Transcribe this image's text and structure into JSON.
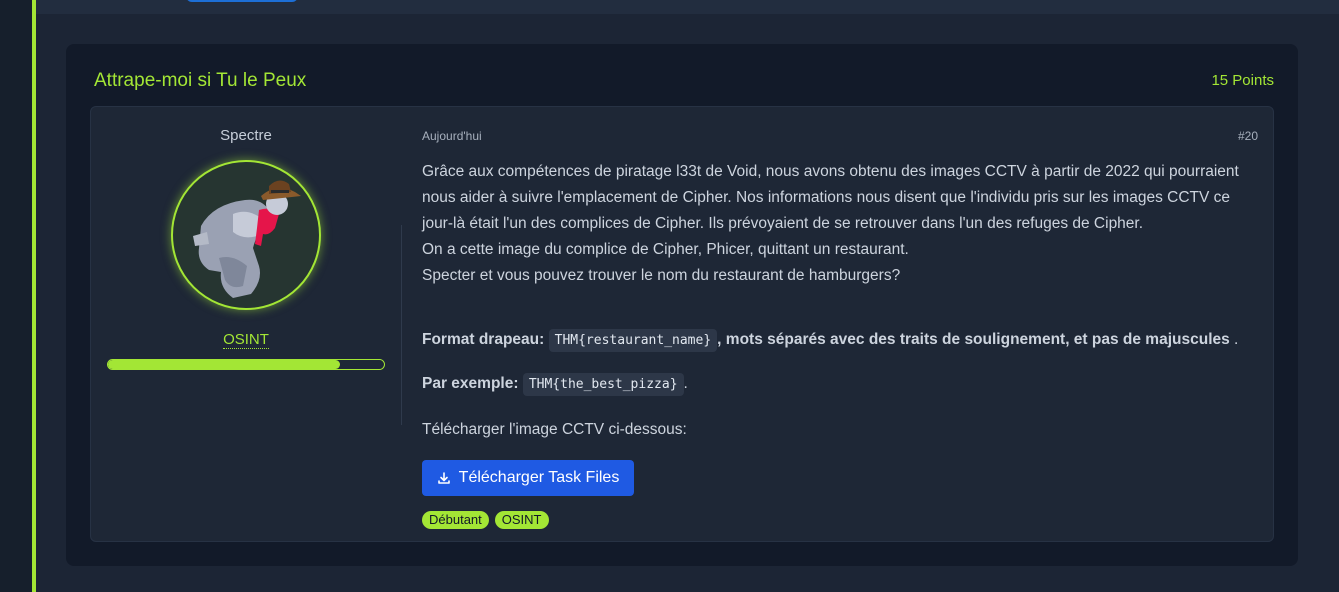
{
  "task": {
    "title": "Attrape-moi si Tu le Peux",
    "points": "15 Points"
  },
  "author": {
    "name": "Spectre",
    "rank": "OSINT",
    "progress_fraction": 0.84
  },
  "post": {
    "date": "Aujourd'hui",
    "number": "#20",
    "paragraph_lines": [
      "Grâce aux compétences de piratage l33t de Void, nous avons obtenu des images CCTV à partir de 2022 qui pourraient nous aider à suivre l'emplacement de Cipher. Nos informations nous disent que l'individu pris sur les images CCTV ce jour-là était l'un des complices de Cipher. Ils prévoyaient de se retrouver dans l'un des refuges de Cipher.",
      "On a cette image du complice de Cipher, Phicer, quittant un restaurant.",
      "Specter et vous pouvez trouver le nom du restaurant de hamburgers?"
    ],
    "format_label": "Format drapeau:",
    "format_code": "THM{restaurant_name}",
    "format_suffix": ", mots séparés avec des traits de soulignement, et pas de majuscules",
    "format_end": " .",
    "example_label": "Par exemple:",
    "example_code": "THM{the_best_pizza}",
    "example_end": ".",
    "download_text": "Télécharger l'image CCTV ci-dessous:",
    "download_button": "Télécharger Task Files",
    "tags": [
      "Débutant",
      "OSINT"
    ]
  },
  "colors": {
    "accent": "#a3e635",
    "button": "#1f5ae3",
    "background": "#1c2535"
  },
  "icons": [
    "download-icon",
    "spy-avatar"
  ]
}
